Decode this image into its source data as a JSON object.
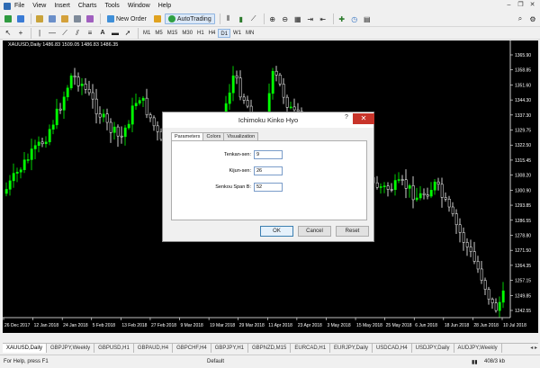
{
  "menu": [
    "File",
    "View",
    "Insert",
    "Charts",
    "Tools",
    "Window",
    "Help"
  ],
  "toolbar": {
    "new_order": "New Order",
    "autotrading": "AutoTrading",
    "timeframes": [
      "M1",
      "M5",
      "M15",
      "M30",
      "H1",
      "H4",
      "D1",
      "W1",
      "MN"
    ],
    "active_timeframe": "D1"
  },
  "chart": {
    "symbol_title": "XAUUSD,Daily  1486.83 1509.05 1486.83 1486.35",
    "price_labels": [
      "1365.90",
      "1358.85",
      "1351.60",
      "1344.30",
      "1337.30",
      "1329.75",
      "1322.50",
      "1315.45",
      "1308.20",
      "1300.90",
      "1293.85",
      "1286.55",
      "1278.80",
      "1271.50",
      "1264.35",
      "1257.15",
      "1249.85",
      "1242.55"
    ],
    "date_labels": [
      "26 Dec 2017",
      "12 Jan 2018",
      "24 Jan 2018",
      "5 Feb 2018",
      "13 Feb 2018",
      "27 Feb 2018",
      "9 Mar 2018",
      "19 Mar 2018",
      "29 Mar 2018",
      "11 Apr 2018",
      "23 Apr 2018",
      "3 May 2018",
      "15 May 2018",
      "25 May 2018",
      "6 Jun 2018",
      "18 Jun 2018",
      "28 Jun 2018",
      "10 Jul 2018"
    ],
    "colors": {
      "background": "#000000",
      "bull": "#00ff00",
      "bear": "#ffffff",
      "axis_text": "#ffffff"
    }
  },
  "dialog": {
    "title": "Ichimoku Kinko Hyo",
    "help": "?",
    "close": "✕",
    "tabs": [
      "Parameters",
      "Colors",
      "Visualization"
    ],
    "fields": [
      {
        "label": "Tenkan-sen:",
        "value": "9"
      },
      {
        "label": "Kijun-sen:",
        "value": "26"
      },
      {
        "label": "Senkou Span B:",
        "value": "52"
      }
    ],
    "buttons": {
      "ok": "OK",
      "cancel": "Cancel",
      "reset": "Reset"
    }
  },
  "sheet_tabs": [
    "XAUUSD,Daily",
    "GBPJPY,Weekly",
    "GBPUSD,H1",
    "GBPAUD,H4",
    "GBPCHF,H4",
    "GBPJPY,H1",
    "GBPNZD,M15",
    "EURCAD,H1",
    "EURJPY,Daily",
    "USDCAD,H4",
    "USDJPY,Daily",
    "AUDJPY,Weekly"
  ],
  "active_sheet_tab": "XAUUSD,Daily",
  "status": {
    "help": "For Help, press F1",
    "profile": "Default",
    "traffic": "408/3 kb"
  }
}
